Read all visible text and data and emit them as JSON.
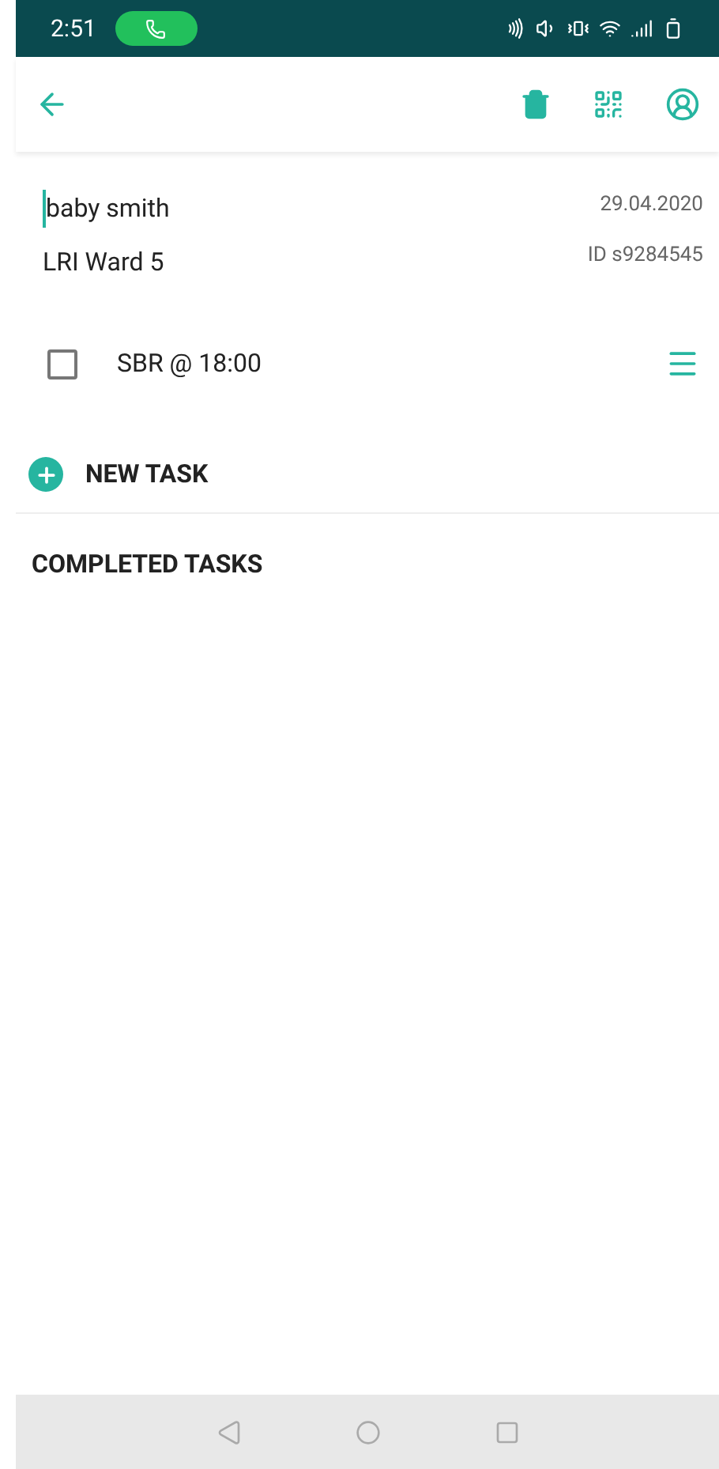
{
  "status_bar": {
    "time": "2:51"
  },
  "patient": {
    "name": "baby smith",
    "ward": "LRI Ward 5",
    "date": "29.04.2020",
    "id": "ID s9284545"
  },
  "tasks": [
    {
      "label": "SBR @ 18:00",
      "checked": false
    }
  ],
  "new_task": "NEW TASK",
  "completed_heading": "COMPLETED TASKS"
}
